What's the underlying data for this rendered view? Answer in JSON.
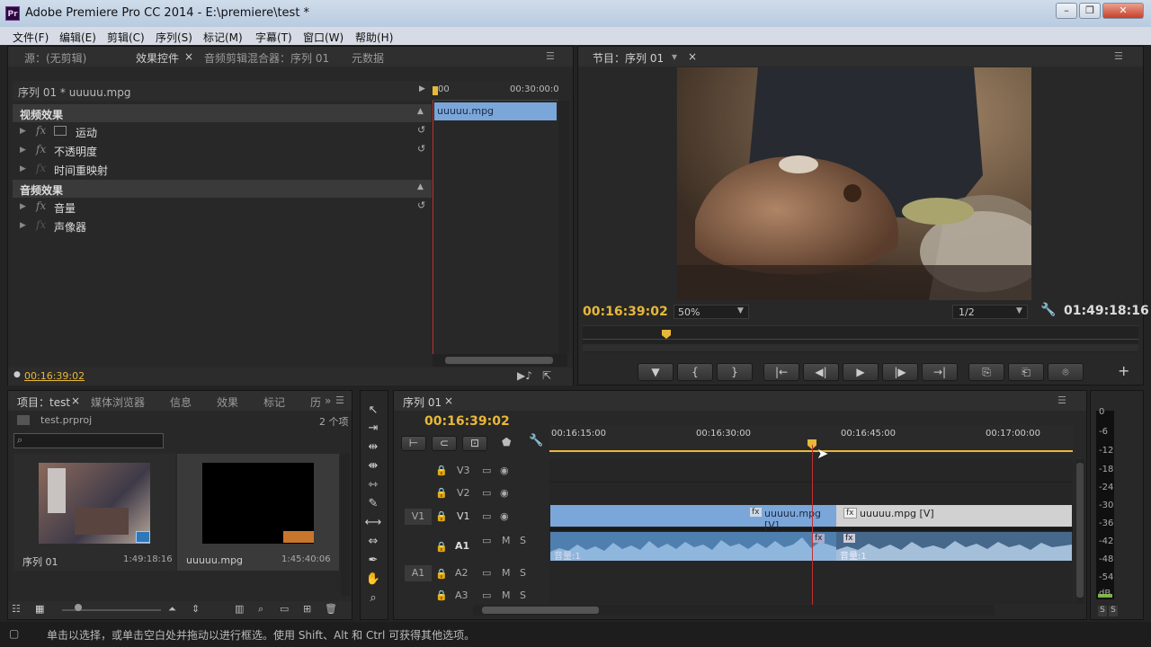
{
  "window": {
    "title": "Adobe Premiere Pro CC 2014 - E:\\premiere\\test *",
    "logo": "Pr",
    "minimize_icon": "–",
    "restore_icon": "❐",
    "close_icon": "✕"
  },
  "menu": [
    "文件(F)",
    "编辑(E)",
    "剪辑(C)",
    "序列(S)",
    "标记(M)",
    "字幕(T)",
    "窗口(W)",
    "帮助(H)"
  ],
  "source_panel": {
    "tabs": [
      "源：(无剪辑)",
      "效果控件",
      "音频剪辑混合器：序列 01",
      "元数据"
    ],
    "close": "×",
    "header": "序列 01 * uuuuu.mpg",
    "ruler_start": "00",
    "ruler_end": "00:30:00:0",
    "clip_label": "uuuuu.mpg",
    "video_section": "视频效果",
    "audio_section": "音频效果",
    "video_effects": [
      "运动",
      "不透明度",
      "时间重映射"
    ],
    "audio_effects": [
      "音量",
      "声像器"
    ],
    "fx_symbol": "fx",
    "timecode": "00:16:39:02"
  },
  "program_panel": {
    "tab": "节目：序列 01",
    "close": "×",
    "timecode": "00:16:39:02",
    "zoom": "50%",
    "resolution": "1/2",
    "duration": "01:49:18:16",
    "controls": [
      "▼",
      "{",
      "}",
      "|←",
      "◀|",
      "▶",
      "|▶",
      "→|",
      "⎘",
      "⎗",
      "⌾"
    ],
    "add": "+"
  },
  "project_panel": {
    "tabs": [
      "项目：test",
      "媒体浏览器",
      "信息",
      "效果",
      "标记",
      "历"
    ],
    "close": "×",
    "more": "»",
    "file": "test.prproj",
    "count": "2 个项",
    "items": [
      {
        "name": "序列 01",
        "duration": "1:49:18:16"
      },
      {
        "name": "uuuuu.mpg",
        "duration": "1:45:40:06"
      }
    ]
  },
  "timeline": {
    "tab": "序列 01",
    "close": "×",
    "timecode": "00:16:39:02",
    "ruler": [
      "00:16:15:00",
      "00:16:30:00",
      "00:16:45:00",
      "00:17:00:00"
    ],
    "video_tracks": [
      "V3",
      "V2",
      "V1"
    ],
    "audio_tracks": [
      "A1",
      "A2",
      "A3"
    ],
    "source_v": "V1",
    "source_a": "A1",
    "mute": "M",
    "solo": "S",
    "clips": [
      "uuuuu.mpg [V]",
      "uuuuu.mpg [V]"
    ],
    "audio_clip_label": "音量:1",
    "fx_badge": "fx"
  },
  "audio_meter": {
    "labels": [
      "0",
      "-6",
      "-12",
      "-18",
      "-24",
      "-30",
      "-36",
      "-42",
      "-48",
      "-54",
      "dB"
    ],
    "solo_buttons": [
      "S",
      "S"
    ]
  },
  "status_bar": {
    "text": "单击以选择，或单击空白处并拖动以进行框选。使用 Shift、Alt 和 Ctrl 可获得其他选项。"
  },
  "colors": {
    "accent_yellow": "#e8b838",
    "playhead_red": "#c03030",
    "video_clip_blue": "#6f9ccf",
    "audio_clip_blue": "#4f7fae",
    "panel_bg": "#282828"
  }
}
